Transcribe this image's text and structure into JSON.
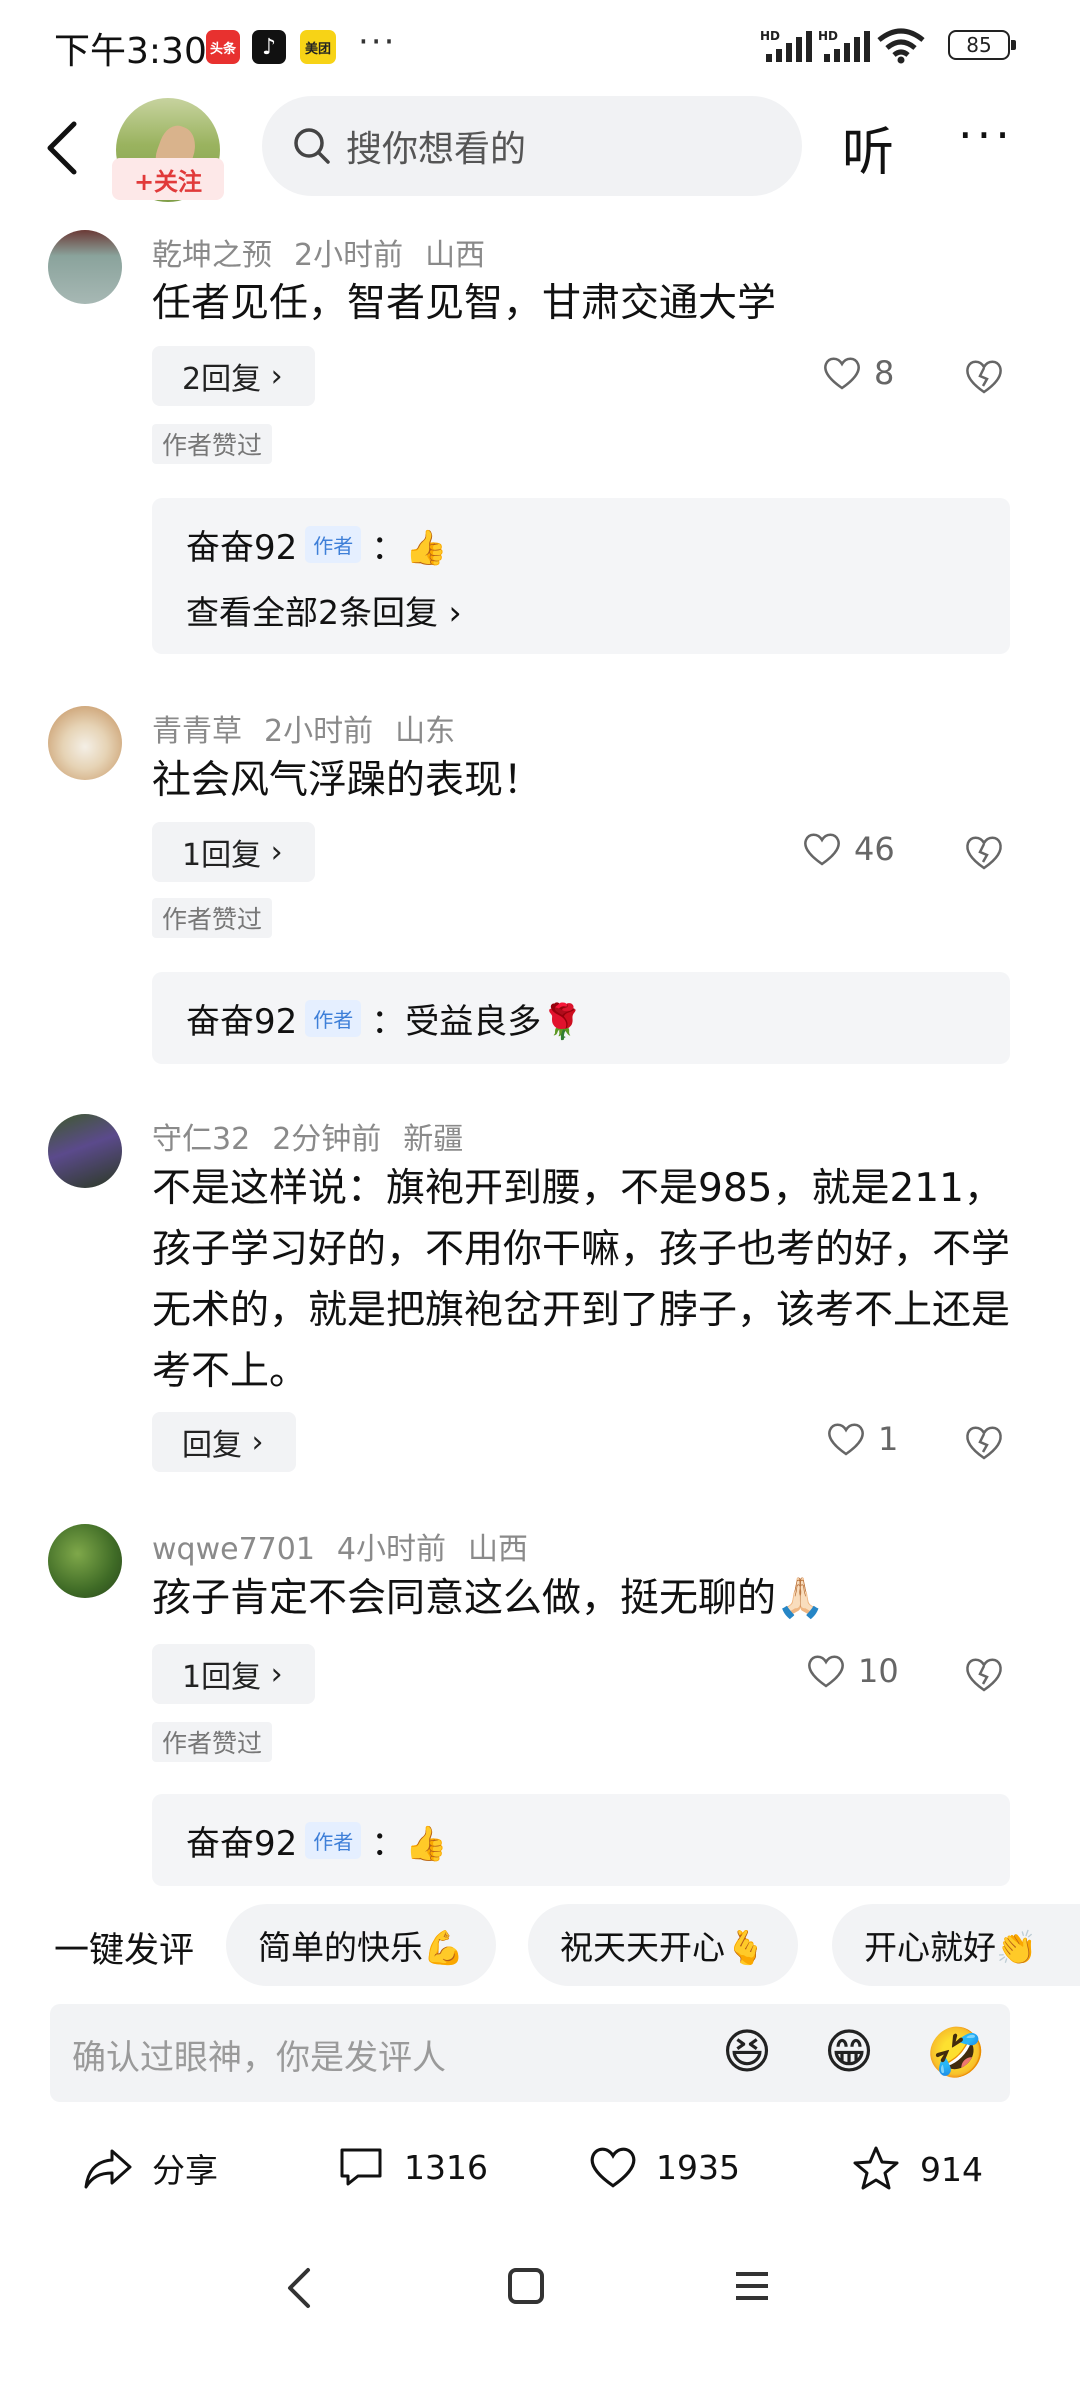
{
  "status_bar": {
    "time": "下午3:30",
    "badges": [
      {
        "name": "toutiao",
        "label": "头条"
      },
      {
        "name": "tiktok",
        "label": "♪"
      },
      {
        "name": "meituan",
        "label": "美团"
      }
    ],
    "dots": "···",
    "battery": "85"
  },
  "header": {
    "follow_label": "+关注",
    "search_placeholder": "搜你想看的",
    "listen_label": "听",
    "more_label": "···"
  },
  "comments": [
    {
      "user": "乾坤之预",
      "time": "2小时前",
      "location": "山西",
      "text": "任者见任，智者见智，甘肃交通大学",
      "reply_count": "2回复",
      "likes": "8",
      "author_liked": "作者赞过",
      "sub_reply": {
        "author": "奋奋92",
        "tag": "作者",
        "content": "：👍",
        "view_all": "查看全部2条回复"
      }
    },
    {
      "user": "青青草",
      "time": "2小时前",
      "location": "山东",
      "text": "社会风气浮躁的表现！",
      "reply_count": "1回复",
      "likes": "46",
      "author_liked": "作者赞过",
      "sub_reply": {
        "author": "奋奋92",
        "tag": "作者",
        "content": "：受益良多🌹"
      }
    },
    {
      "user": "守仁32",
      "time": "2分钟前",
      "location": "新疆",
      "text": "不是这样说：旗袍开到腰，不是985，就是211，孩子学习好的，不用你干嘛，孩子也考的好，不学无术的，就是把旗袍岔开到了脖子，该考不上还是考不上。",
      "reply_count": "回复",
      "likes": "1"
    },
    {
      "user": "wqwe7701",
      "time": "4小时前",
      "location": "山西",
      "text": "孩子肯定不会同意这么做，挺无聊的🙏🏻",
      "reply_count": "1回复",
      "likes": "10",
      "author_liked": "作者赞过",
      "sub_reply": {
        "author": "奋奋92",
        "tag": "作者",
        "content": "：👍"
      }
    }
  ],
  "quick_comments": {
    "label": "一键发评",
    "chips": [
      "简单的快乐💪",
      "祝天天开心🫰",
      "开心就好👏"
    ]
  },
  "input": {
    "placeholder": "确认过眼神，你是发评人",
    "emojis": [
      "😆",
      "😁",
      "🤣"
    ]
  },
  "actions": {
    "share": "分享",
    "comments": "1316",
    "likes": "1935",
    "favorites": "914"
  }
}
